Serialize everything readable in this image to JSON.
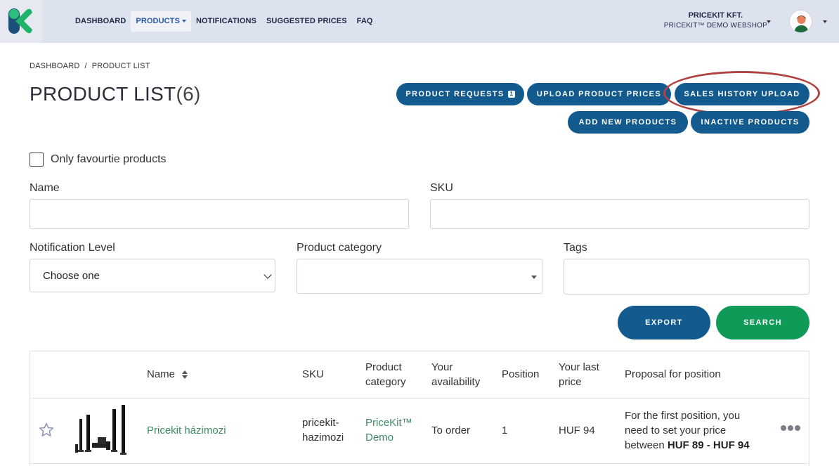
{
  "nav": {
    "items": [
      {
        "label": "DASHBOARD"
      },
      {
        "label": "PRODUCTS"
      },
      {
        "label": "NOTIFICATIONS"
      },
      {
        "label": "SUGGESTED PRICES"
      },
      {
        "label": "FAQ"
      }
    ],
    "account": {
      "company": "PRICEKIT KFT.",
      "shop": "PRICEKIT™ DEMO WEBSHOP"
    }
  },
  "breadcrumb": {
    "home": "DASHBOARD",
    "separator": "/",
    "current": "PRODUCT LIST"
  },
  "page": {
    "title": "PRODUCT LIST",
    "count": "(6)"
  },
  "actions": {
    "product_requests": "PRODUCT REQUESTS",
    "product_requests_badge": "1",
    "upload_prices": "UPLOAD PRODUCT PRICES",
    "sales_history": "SALES HISTORY UPLOAD",
    "add_new": "ADD NEW PRODUCTS",
    "inactive": "INACTIVE PRODUCTS"
  },
  "filters": {
    "favourites_label": "Only favourtie products",
    "name_label": "Name",
    "sku_label": "SKU",
    "notification_label": "Notification Level",
    "notification_value": "Choose one",
    "category_label": "Product category",
    "tags_label": "Tags",
    "export": "EXPORT",
    "search": "SEARCH"
  },
  "table": {
    "headers": {
      "name": "Name",
      "sku": "SKU",
      "category_line1": "Product",
      "category_line2": "category",
      "availability_line1": "Your",
      "availability_line2": "availability",
      "position": "Position",
      "last_price_line1": "Your last",
      "last_price_line2": "price",
      "proposal": "Proposal for position"
    },
    "rows": [
      {
        "name": "Pricekit házimozi",
        "sku_line1": "pricekit-",
        "sku_line2": "hazimozi",
        "category_line1": "PriceKit™",
        "category_line2": "Demo",
        "availability": "To order",
        "position": "1",
        "last_price": "HUF 94",
        "proposal_line1": "For the first position, you",
        "proposal_line2": "need to set your price",
        "proposal_line3_prefix": "between",
        "proposal_range": "HUF 89 - HUF 94"
      }
    ]
  },
  "colors": {
    "primary": "#135a8e",
    "success": "#0f9a58",
    "highlight": "#b04444",
    "link": "#3e8c65"
  }
}
